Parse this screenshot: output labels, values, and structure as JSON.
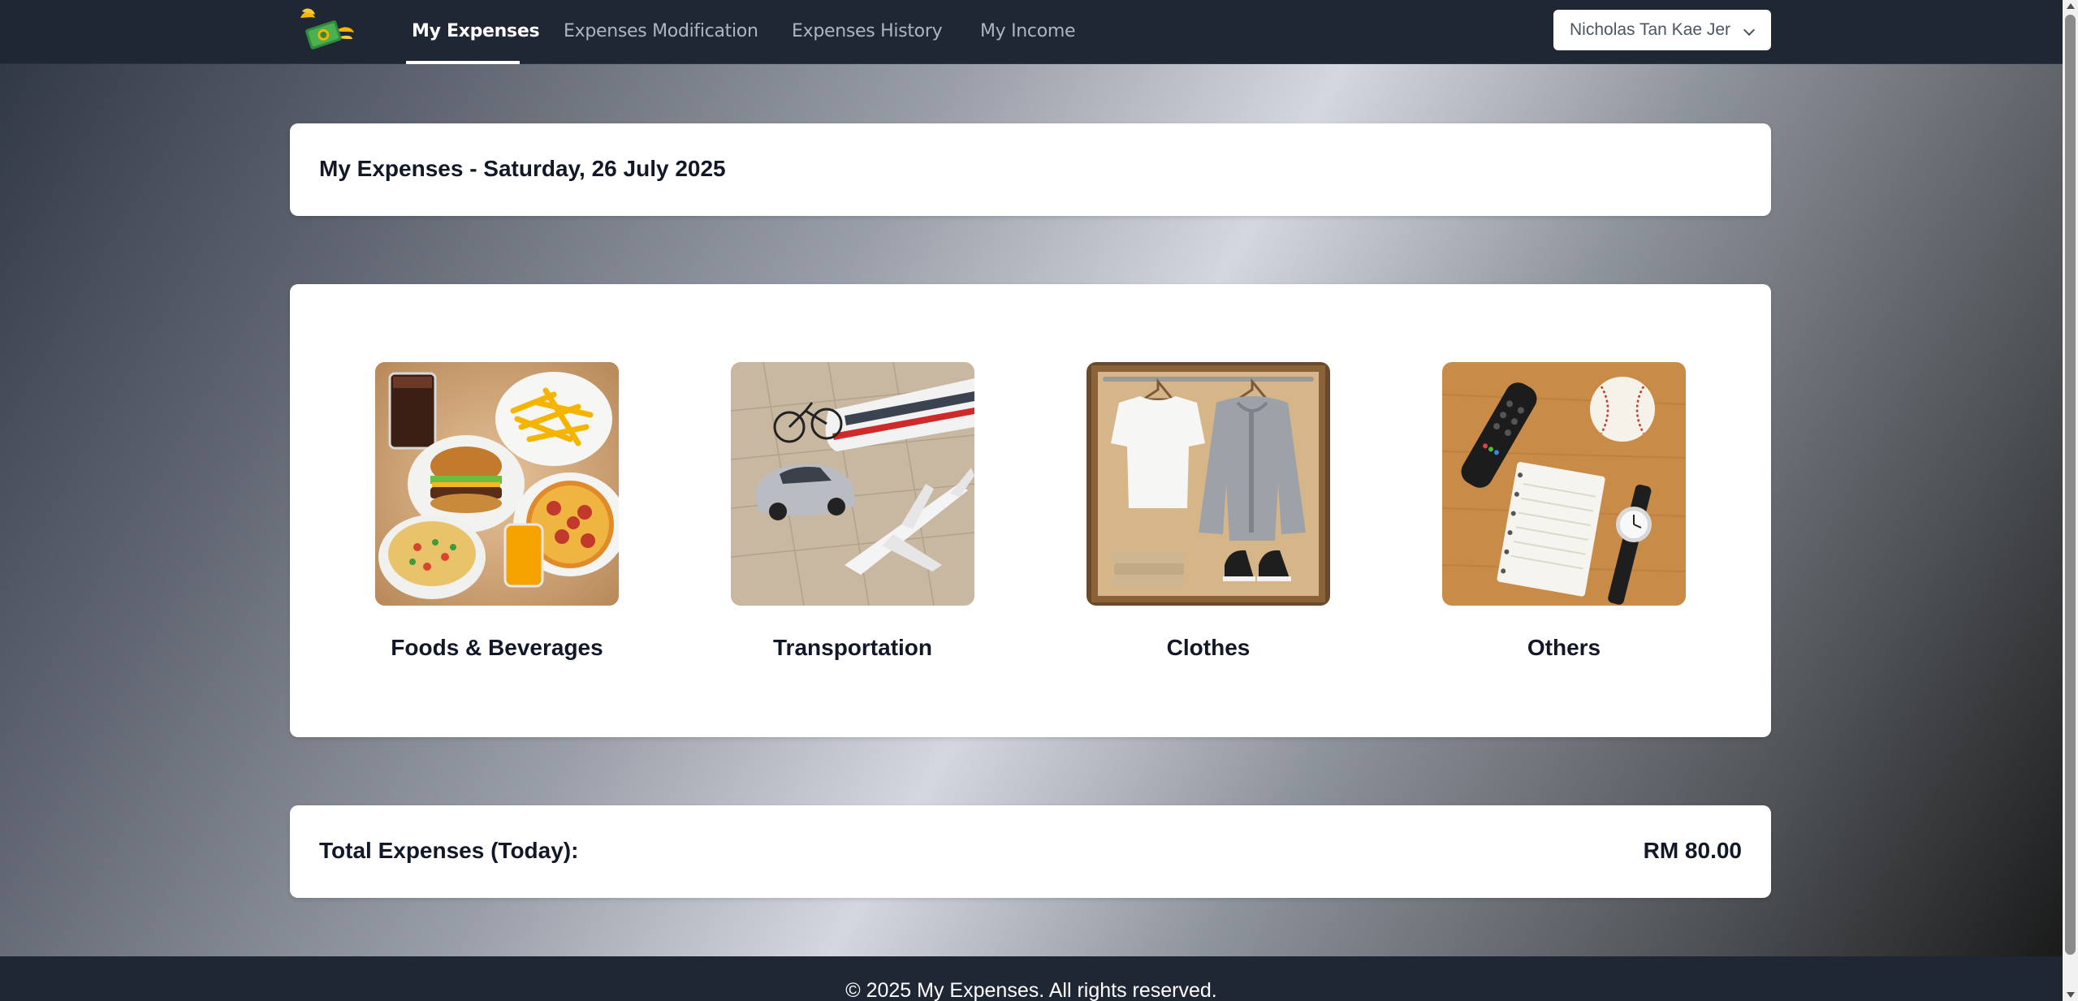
{
  "nav": {
    "items": [
      {
        "label": "My Expenses",
        "active": true
      },
      {
        "label": "Expenses Modification",
        "active": false
      },
      {
        "label": "Expenses History",
        "active": false
      },
      {
        "label": "My Income",
        "active": false
      }
    ],
    "user": "Nicholas Tan Kae Jer"
  },
  "header": {
    "title": "My Expenses - Saturday, 26 July 2025"
  },
  "categories": [
    {
      "label": "Foods & Beverages",
      "icon": "food-image"
    },
    {
      "label": "Transportation",
      "icon": "transport-image"
    },
    {
      "label": "Clothes",
      "icon": "clothes-image"
    },
    {
      "label": "Others",
      "icon": "others-image"
    }
  ],
  "total": {
    "label": "Total Expenses (Today):",
    "amount": "RM 80.00"
  },
  "footer": {
    "text": "© 2025 My Expenses. All rights reserved."
  },
  "colors": {
    "navbar": "#1f2634",
    "card": "#ffffff",
    "text": "#111827"
  }
}
